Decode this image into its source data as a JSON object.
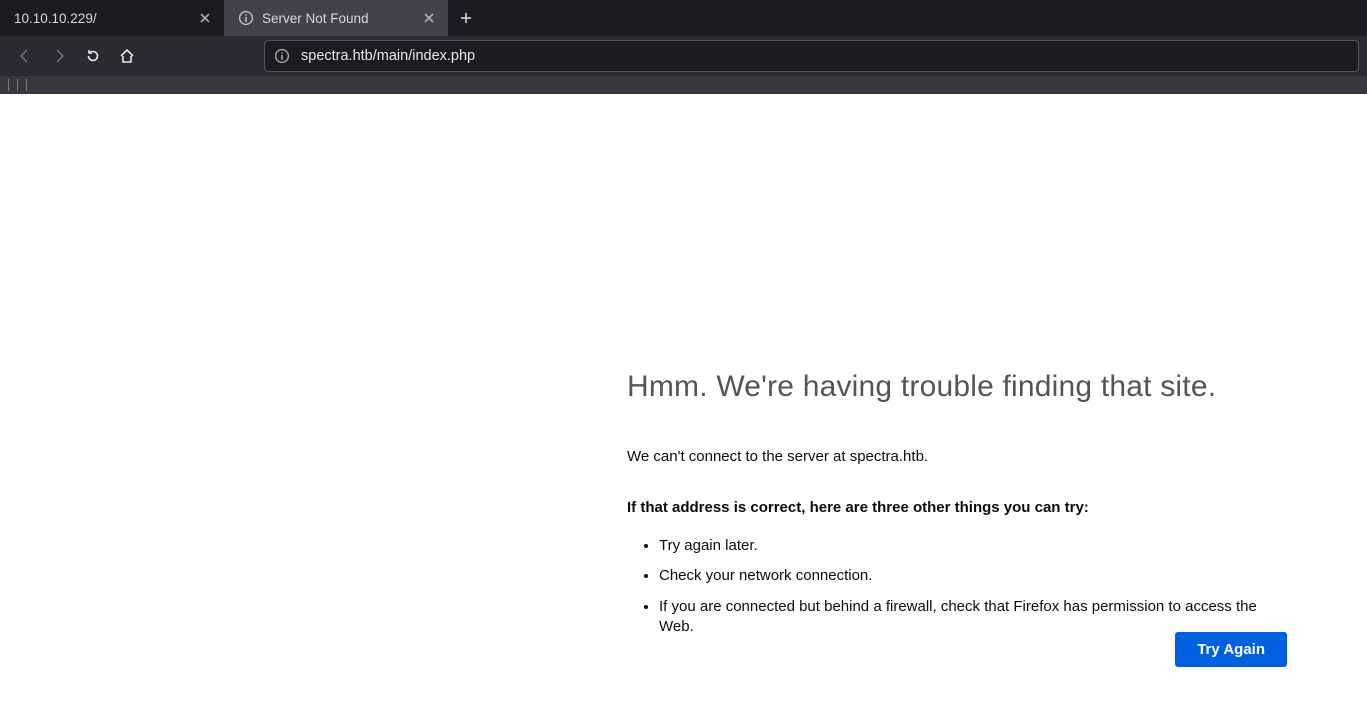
{
  "tabs": [
    {
      "title": "10.10.10.229/",
      "active": false
    },
    {
      "title": "Server Not Found",
      "active": true
    }
  ],
  "toolbar": {
    "url": "spectra.htb/main/index.php"
  },
  "error": {
    "title": "Hmm. We're having trouble finding that site.",
    "para": "We can't connect to the server at spectra.htb.",
    "sub": "If that address is correct, here are three other things you can try:",
    "items": [
      "Try again later.",
      "Check your network connection.",
      "If you are connected but behind a firewall, check that Firefox has permission to access the Web."
    ],
    "button": "Try Again"
  }
}
